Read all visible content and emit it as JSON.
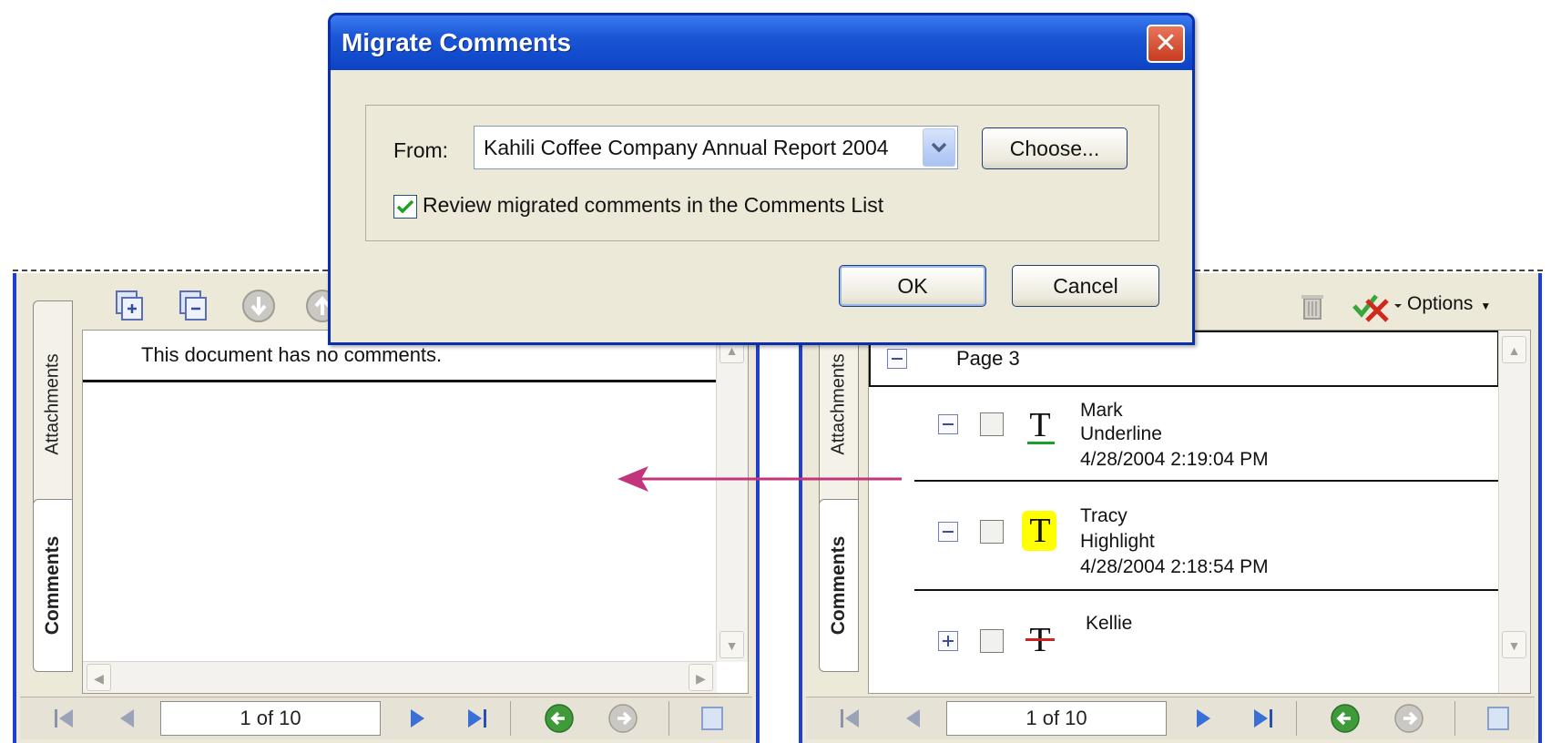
{
  "dialog": {
    "title": "Migrate Comments",
    "close_glyph": "✕",
    "from_label": "From:",
    "from_value": "Kahili Coffee Company Annual Report 2004",
    "choose_label": "Choose...",
    "review_checkbox_label": "Review migrated comments in the Comments List",
    "review_checked": true,
    "ok_label": "OK",
    "cancel_label": "Cancel"
  },
  "left_pane": {
    "tabs": [
      "Attachments",
      "Comments"
    ],
    "empty_message": "This document has no comments.",
    "page_indicator": "1 of 10"
  },
  "right_pane": {
    "tabs": [
      "Attachments",
      "Comments"
    ],
    "options_label": "Options",
    "close_glyph": "✕",
    "page_group": "Page 3",
    "comments": [
      {
        "author": "Mark",
        "type": "Underline",
        "date": "4/28/2004 2:19:04 PM",
        "icon": "underline-text-icon"
      },
      {
        "author": "Tracy",
        "type": "Highlight",
        "date": "4/28/2004 2:18:54 PM",
        "icon": "highlight-text-icon"
      },
      {
        "author": "Kellie",
        "icon": "strikeout-text-icon"
      }
    ],
    "page_indicator": "1 of 10"
  },
  "colors": {
    "xp_blue_border": "#1f3fd0",
    "titlebar": "#1a56d6",
    "arrow": "#c2357a",
    "highlight": "#ffff00",
    "underline": "#1aa02a",
    "strikeout": "#d02020"
  }
}
